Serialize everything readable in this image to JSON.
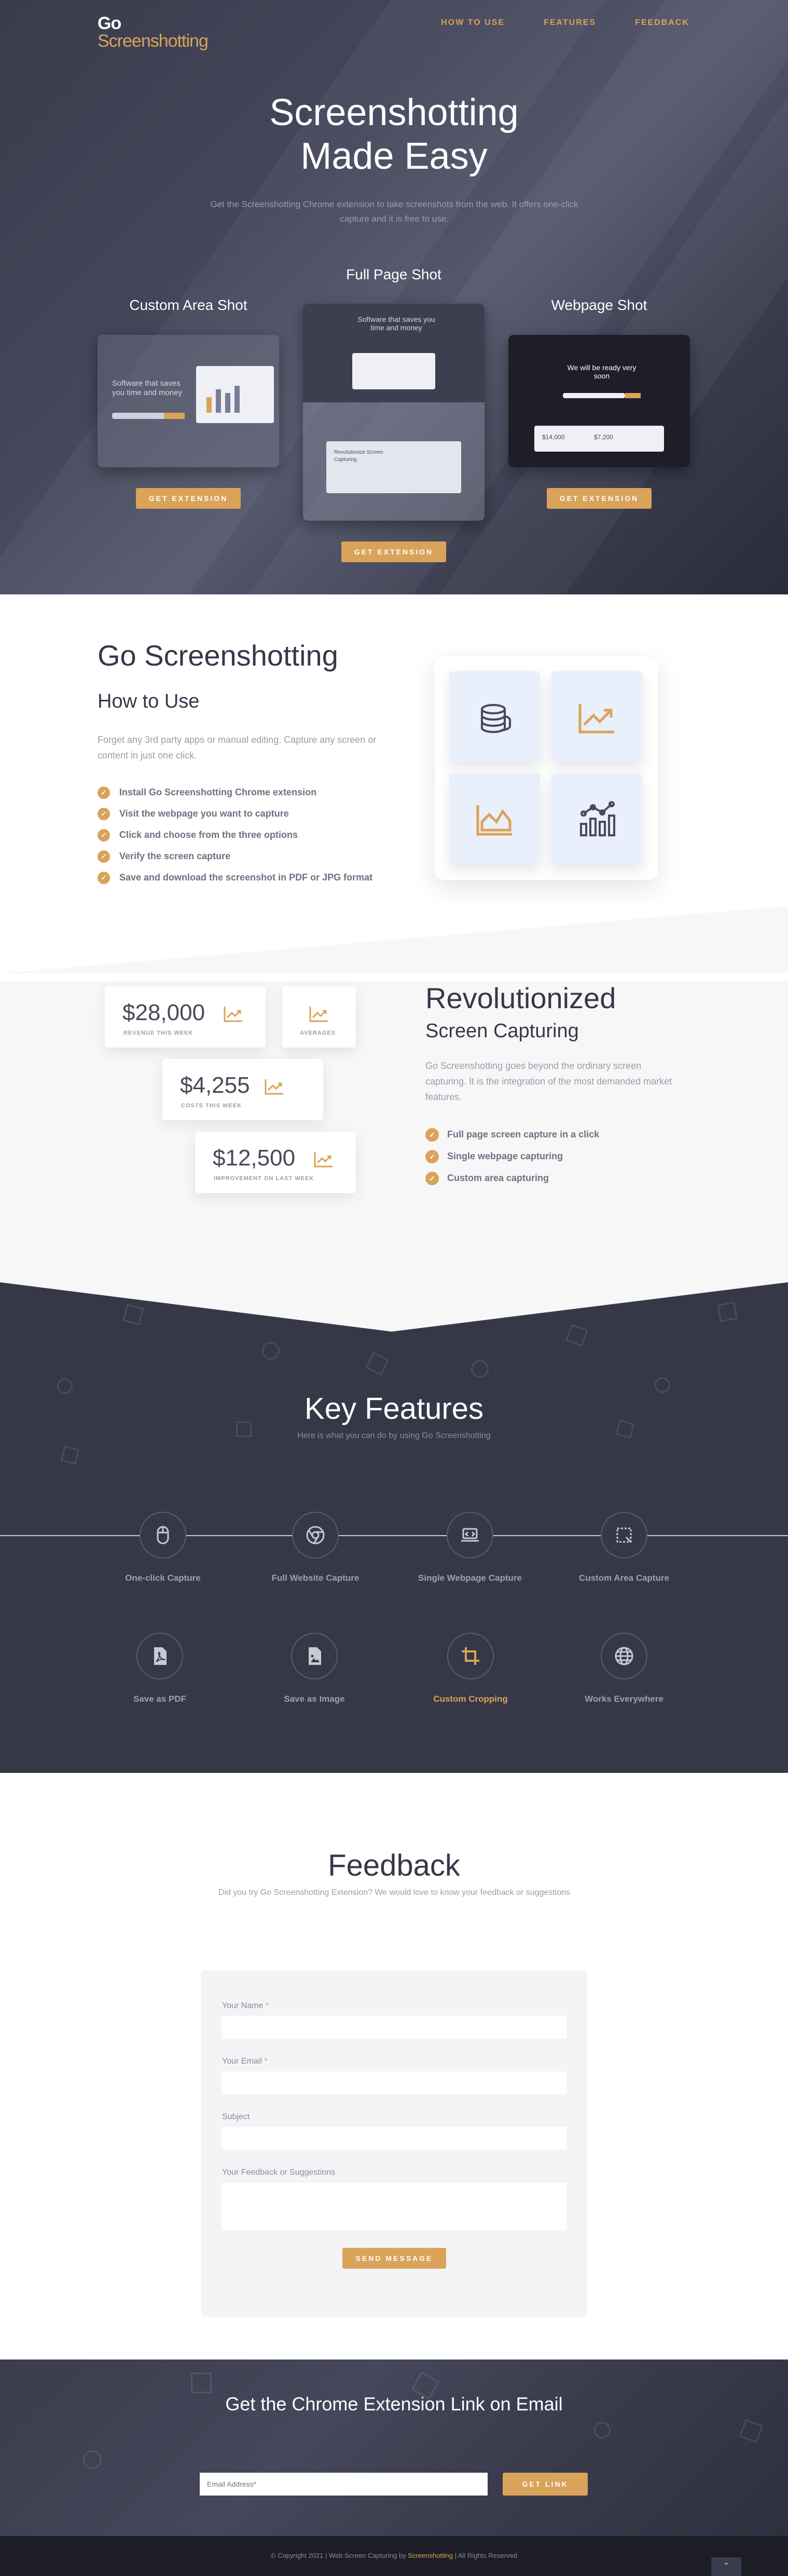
{
  "nav": {
    "logo_line1": "Go",
    "logo_line2": "Screenshotting",
    "links": [
      "HOW TO USE",
      "FEATURES",
      "FEEDBACK"
    ]
  },
  "hero": {
    "title_line1": "Screenshotting",
    "title_line2": "Made Easy",
    "subtitle": "Get the Screenshotting Chrome extension to take screenshots from the web. It offers one-click capture and it is free to use.",
    "shots": {
      "left_title": "Custom Area Shot",
      "mid_title": "Full Page Shot",
      "right_title": "Webpage Shot"
    },
    "button_label": "GET EXTENSION",
    "mock": {
      "left_heading": "Software that saves you time and money",
      "mid_heading": "Software that saves you time and money",
      "right_heading": "We will be ready very soon",
      "mid_subheading": "Revolutionize Screen Capturing",
      "right_stat1": "$14,000",
      "right_stat2": "$7,200"
    }
  },
  "how": {
    "title": "Go Screenshotting",
    "subtitle": "How to Use",
    "description": "Forget any 3rd party apps or manual editing. Capture any screen or content in just one click.",
    "steps": [
      "Install Go Screenshotting Chrome extension",
      "Visit the webpage you want to capture",
      "Click and choose from the three options",
      "Verify the screen capture",
      "Save and download the screenshot in PDF or JPG format"
    ],
    "tile_icons": [
      "coins-icon",
      "trend-up-icon",
      "area-chart-icon",
      "bar-chart-icon"
    ]
  },
  "revolution": {
    "title": "Revolutionized",
    "subtitle": "Screen Capturing",
    "description": "Go Screenshotting goes beyond the ordinary screen capturing. It is the integration of the most demanded market features.",
    "checks": [
      "Full page screen capture in a click",
      "Single webpage capturing",
      "Custom area capturing"
    ],
    "stats": [
      {
        "value": "$28,000",
        "label": "REVENUE THIS WEEK"
      },
      {
        "value": "",
        "label": "AVERAGES"
      },
      {
        "value": "$4,255",
        "label": "COSTS THIS WEEK"
      },
      {
        "value": "$12,500",
        "label": "IMPROVEMENT ON LAST WEEK"
      }
    ]
  },
  "features": {
    "title": "Key Features",
    "subtitle": "Here is what you can do by using Go Screenshotting",
    "items": [
      {
        "name": "One-click Capture",
        "icon": "mouse-icon"
      },
      {
        "name": "Full Website Capture",
        "icon": "chrome-icon"
      },
      {
        "name": "Single Webpage Capture",
        "icon": "laptop-icon"
      },
      {
        "name": "Custom Area Capture",
        "icon": "crop-area-icon"
      },
      {
        "name": "Save as PDF",
        "icon": "pdf-file-icon"
      },
      {
        "name": "Save as Image",
        "icon": "image-file-icon"
      },
      {
        "name": "Custom Cropping",
        "icon": "crop-icon"
      },
      {
        "name": "Works Everywhere",
        "icon": "globe-icon"
      }
    ],
    "highlight_color": "#d9a35a"
  },
  "feedback": {
    "title": "Feedback",
    "subtitle": "Did you try Go Screenshotting Extension? We would love to know your feedback or suggestions",
    "fields": {
      "name_label": "Your Name",
      "email_label": "Your Email",
      "subject_label": "Subject",
      "message_label": "Your Feedback or Suggestions",
      "required_mark": "*"
    },
    "send_label": "SEND MESSAGE"
  },
  "newsletter": {
    "title": "Get the Chrome Extension Link on Email",
    "email_placeholder": "Email Address*",
    "button_label": "GET LINK"
  },
  "footer": {
    "copyright_prefix": "© Copyright 2021 | Web Screen Capturing by",
    "link_text": "Screenshotting",
    "copyright_suffix": "| All Rights Reserved",
    "to_top": "⌃"
  },
  "colors": {
    "accent": "#d9a35a",
    "dark": "#363848",
    "footer": "#1c1d26"
  }
}
